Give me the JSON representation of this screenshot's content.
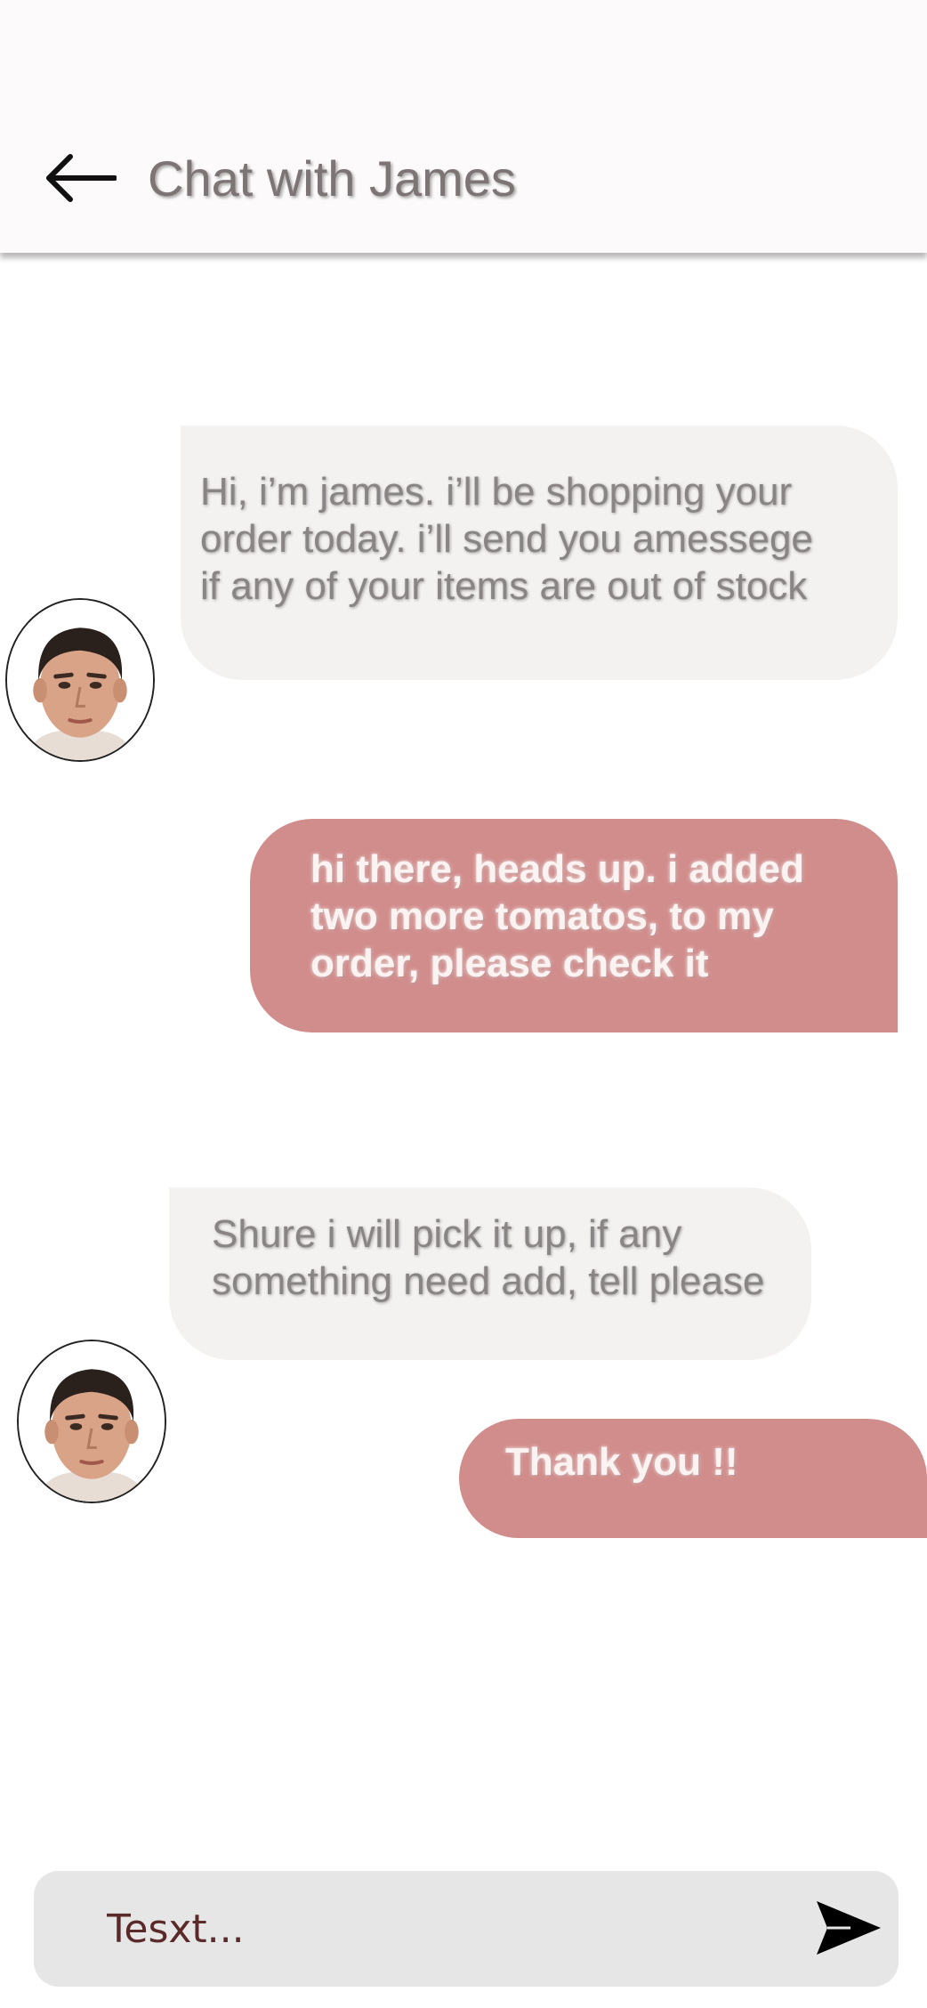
{
  "header": {
    "title": "Chat with James",
    "back_icon": "arrow-left-icon"
  },
  "messages": [
    {
      "sender": "james",
      "text": "Hi, i’m james. i’ll be shopping your\norder today. i’ll send  you amessege\nif any of your items are out of stock"
    },
    {
      "sender": "me",
      "text": "hi there, heads up. i added\ntwo more tomatos, to my\norder, please check it"
    },
    {
      "sender": "james",
      "text": "Shure i will pick it up, if any\nsomething need add, tell please"
    },
    {
      "sender": "me",
      "text": "Thank you !!"
    }
  ],
  "composer": {
    "placeholder": "Tesxt...",
    "value": "",
    "send_icon": "send-icon"
  },
  "colors": {
    "header_bg": "#fcfafa",
    "incoming_bubble": "#f4f2f1",
    "outgoing_bubble": "#d18d8c",
    "composer_bg": "#e6e6e6",
    "title_text": "#7d7575"
  }
}
